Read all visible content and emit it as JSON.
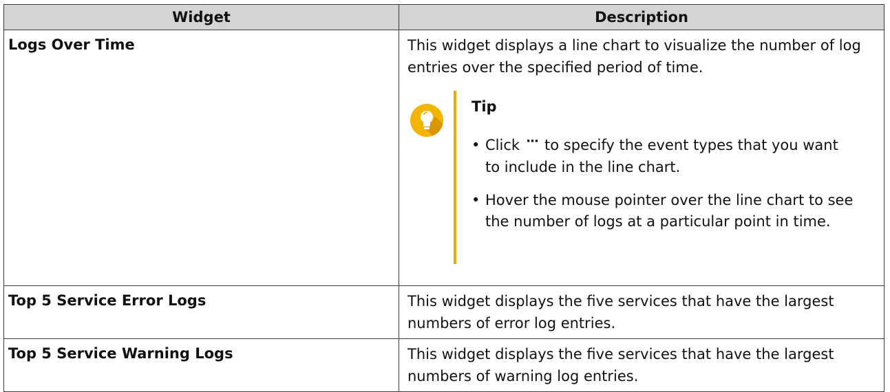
{
  "table": {
    "headers": [
      "Widget",
      "Description"
    ],
    "rows": [
      {
        "widget": "Logs Over Time",
        "description": "This widget displays a line chart to visualize the number of log entries over the specified period of time.",
        "tip": {
          "title": "Tip",
          "items": [
            {
              "before_icon": "Click",
              "icon": "more-icon",
              "icon_glyph": "···",
              "after_icon": "to specify the event types that you want to include in the line chart."
            },
            {
              "text": "Hover the mouse pointer over the line chart to see the number of logs at a particular point in time."
            }
          ]
        }
      },
      {
        "widget": "Top 5 Service Error Logs",
        "description": "This widget displays the five services that have the largest numbers of error log entries."
      },
      {
        "widget": "Top 5 Service Warning Logs",
        "description": "This widget displays the five services that have the largest numbers of warning log entries."
      }
    ]
  },
  "colors": {
    "header_bg": "#d4d4d4",
    "border": "#3a3a3a",
    "tip_accent": "#f0ab00",
    "tip_icon_bg": "#f3b400"
  }
}
